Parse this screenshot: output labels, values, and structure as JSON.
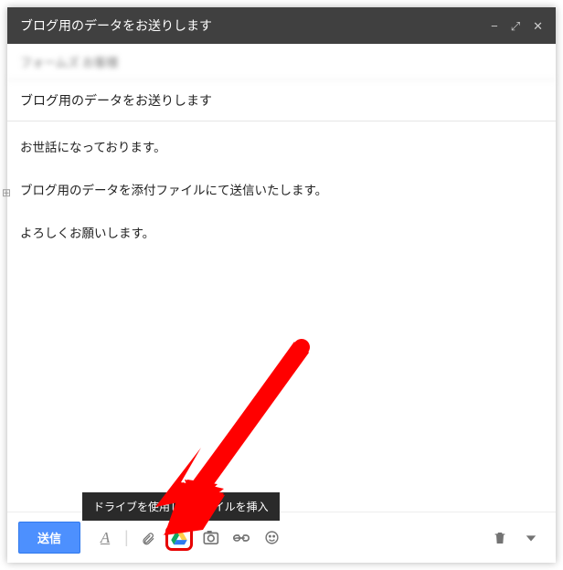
{
  "header": {
    "title": "ブログ用のデータをお送りします"
  },
  "to": {
    "display": "フォームズ お客様"
  },
  "subject": {
    "value": "ブログ用のデータをお送りします"
  },
  "body": {
    "line1": "お世話になっております。",
    "line2": "ブログ用のデータを添付ファイルにて送信いたします。",
    "line3": "よろしくお願いします。"
  },
  "toolbar": {
    "send_label": "送信"
  },
  "tooltip": {
    "drive": "ドライブを使用してファイルを挿入"
  }
}
